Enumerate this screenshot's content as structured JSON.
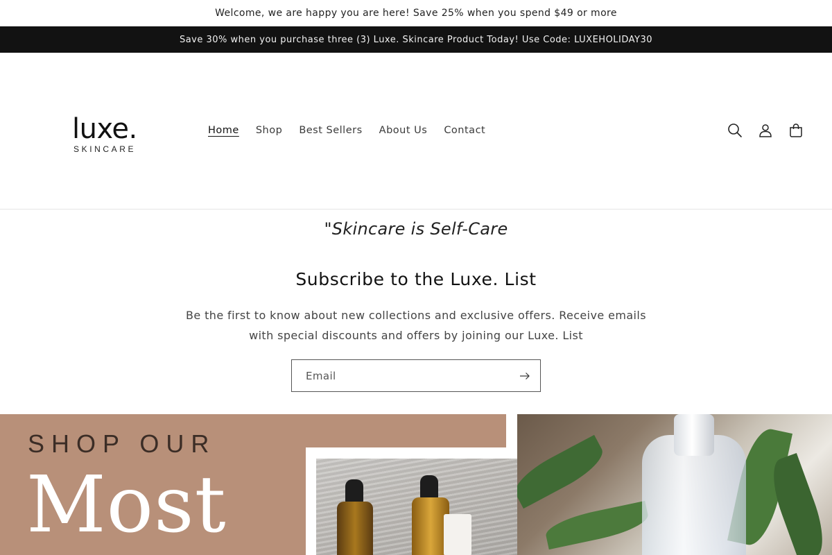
{
  "announcements": {
    "top": "Welcome, we are happy you are here! Save 25% when you spend $49 or more",
    "promo": "Save 30% when you purchase three (3) Luxe. Skincare Product Today! Use Code: LUXEHOLIDAY30"
  },
  "header": {
    "logo_word": "luxe.",
    "logo_sub": "SKINCARE",
    "nav": [
      {
        "label": "Home",
        "active": true
      },
      {
        "label": "Shop",
        "active": false
      },
      {
        "label": "Best Sellers",
        "active": false
      },
      {
        "label": "About Us",
        "active": false
      },
      {
        "label": "Contact",
        "active": false
      }
    ],
    "icons": [
      "search-icon",
      "account-icon",
      "cart-icon"
    ]
  },
  "quote": "\"Skincare is Self-Care",
  "newsletter": {
    "title": "Subscribe to the Luxe. List",
    "text": "Be the first to know about new collections and exclusive offers. Receive emails with special discounts and offers by joining our Luxe. List",
    "email_placeholder": "Email"
  },
  "banner": {
    "line1": "SHOP OUR",
    "line2": "Most",
    "bg_color": "#b89079"
  },
  "colors": {
    "announcement_bg": "#121212",
    "text": "#121212"
  }
}
